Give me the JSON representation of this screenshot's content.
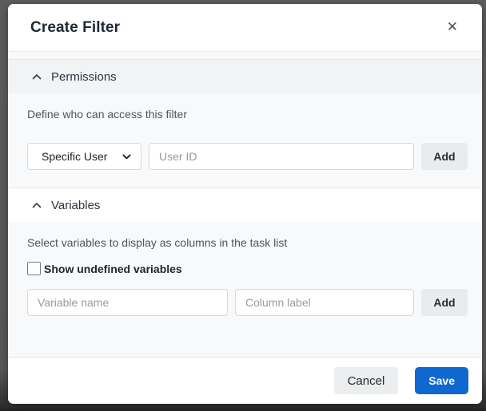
{
  "modal": {
    "title": "Create Filter",
    "close_glyph": "✕"
  },
  "permissions": {
    "label": "Permissions",
    "description": "Define who can access this filter",
    "type_select_value": "Specific User",
    "user_id_placeholder": "User ID",
    "add_label": "Add"
  },
  "variables": {
    "label": "Variables",
    "description": "Select variables to display as columns in the task list",
    "checkbox_label": "Show undefined variables",
    "checkbox_checked": false,
    "variable_name_placeholder": "Variable name",
    "column_label_placeholder": "Column label",
    "add_label": "Add"
  },
  "footer": {
    "cancel_label": "Cancel",
    "save_label": "Save"
  },
  "colors": {
    "primary_blue": "#0f68cf",
    "body_gray": "#f8f9fa",
    "section_head_gray": "#f2f3f4",
    "button_gray": "#e9ecee"
  }
}
